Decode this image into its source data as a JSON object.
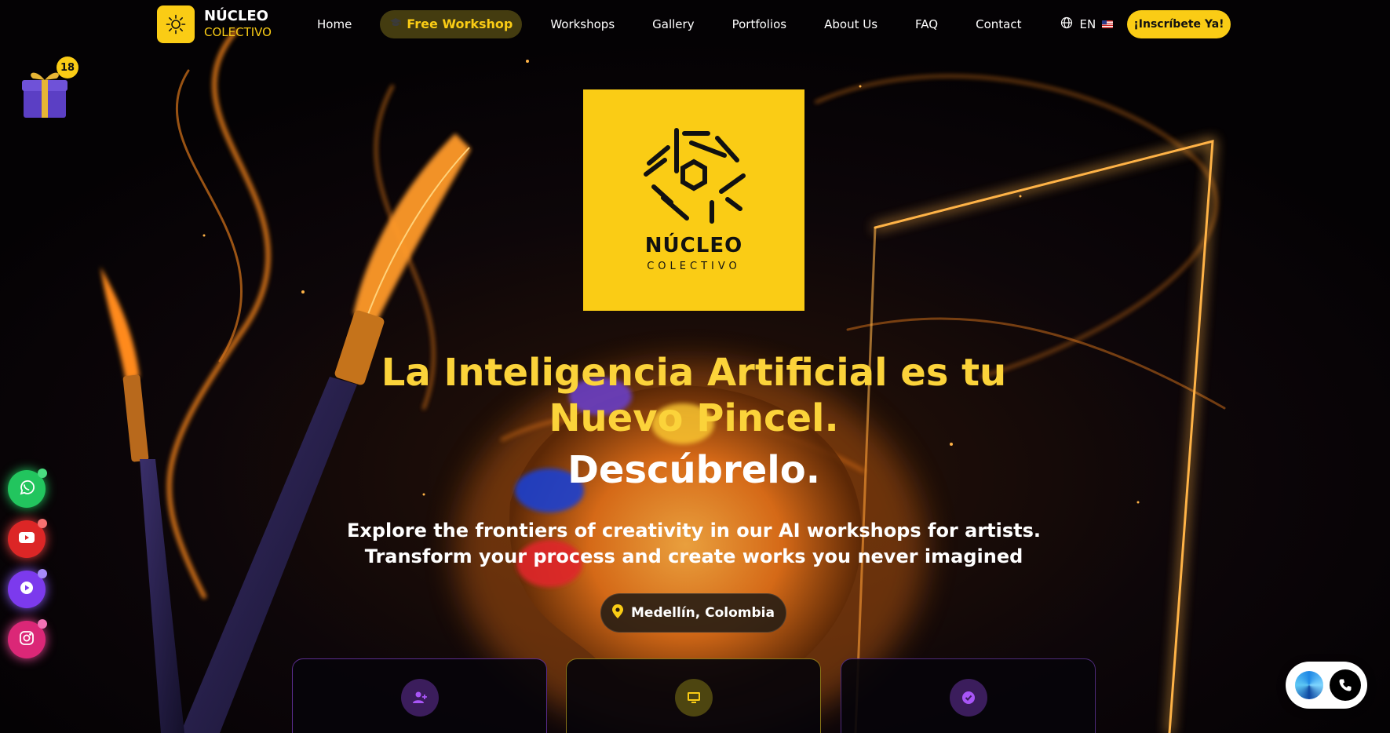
{
  "colors": {
    "accent": "#FACC15",
    "headline": "#FBD33A",
    "background": "#050305",
    "glow": "#FF8A1F"
  },
  "header": {
    "brand": {
      "name": "NÚCLEO",
      "sub": "COLECTIVO",
      "icon": "sun-icon"
    },
    "nav": [
      {
        "label": "Home"
      },
      {
        "label": "Free Workshop",
        "icon": "graduation-cap-icon",
        "highlighted": true
      },
      {
        "label": "Workshops"
      },
      {
        "label": "Gallery"
      },
      {
        "label": "Portfolios"
      },
      {
        "label": "About Us"
      },
      {
        "label": "FAQ"
      },
      {
        "label": "Contact"
      }
    ],
    "language": {
      "code": "EN",
      "icon": "globe-icon",
      "flag": "us-flag-icon"
    },
    "cta_label": "¡Inscríbete Ya!"
  },
  "gift": {
    "icon": "gift-icon",
    "badge": "18"
  },
  "hero": {
    "logo": {
      "name": "NÚCLEO",
      "sub": "COLECTIVO"
    },
    "headline_line1": "La Inteligencia Artificial es tu",
    "headline_line2": "Nuevo Pincel.",
    "headline_line3": "Descúbrelo.",
    "tagline_line1": "Explore the frontiers of creativity in our AI workshops for artists.",
    "tagline_line2": "Transform your process and create works you never imagined",
    "location": {
      "icon": "map-pin-icon",
      "label": "Medellín, Colombia"
    }
  },
  "cards": [
    {
      "icon": "user-plus-icon",
      "color": "#A855F7"
    },
    {
      "icon": "monitor-icon",
      "color": "#FACC15"
    },
    {
      "icon": "check-badge-icon",
      "color": "#A855F7"
    }
  ],
  "social": [
    {
      "name": "whatsapp",
      "icon": "whatsapp-icon",
      "color": "#22C55E"
    },
    {
      "name": "youtube",
      "icon": "youtube-icon",
      "color": "#EF4444"
    },
    {
      "name": "video",
      "icon": "play-icon",
      "color": "#8B5CF6"
    },
    {
      "name": "instagram",
      "icon": "instagram-icon",
      "color": "#EC4899"
    }
  ],
  "call_widget": {
    "icon": "phone-icon"
  }
}
